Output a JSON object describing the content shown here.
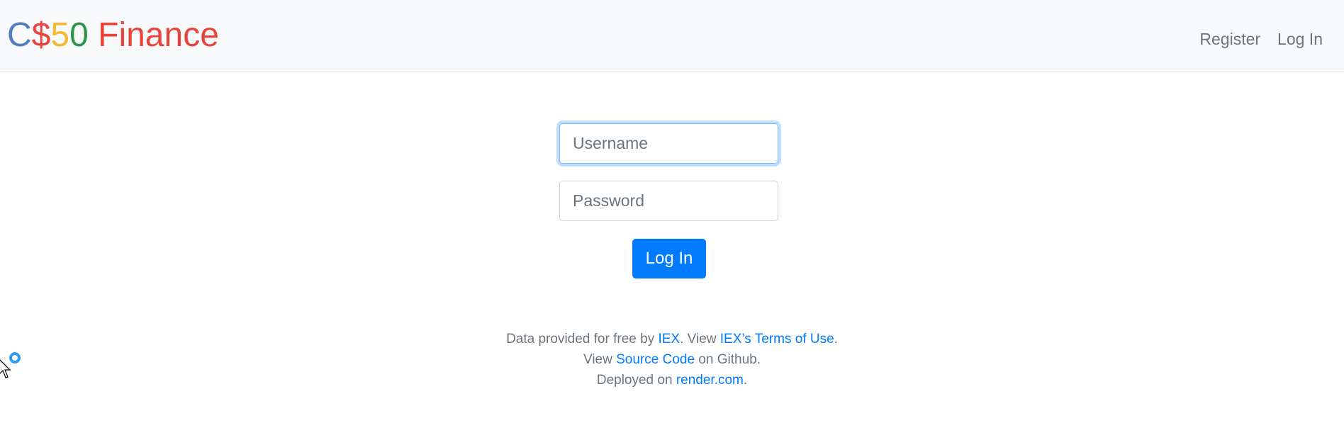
{
  "brand": {
    "parts": [
      {
        "text": "C",
        "color": "#537fbe"
      },
      {
        "text": "$",
        "color": "#ea433b"
      },
      {
        "text": "5",
        "color": "#f5b82e"
      },
      {
        "text": "0",
        "color": "#2e944b"
      },
      {
        "text": " Finance",
        "color": "#ea433b"
      }
    ]
  },
  "nav": {
    "register_label": "Register",
    "login_label": "Log In"
  },
  "form": {
    "username_placeholder": "Username",
    "password_placeholder": "Password",
    "submit_label": "Log In"
  },
  "footer": {
    "line1_prefix": "Data provided for free by ",
    "line1_link1": "IEX",
    "line1_mid": ". View ",
    "line1_link2": "IEX’s Terms of Use",
    "line1_suffix": ".",
    "line2_prefix": "View ",
    "line2_link": "Source Code",
    "line2_suffix": " on Github.",
    "line3_prefix": "Deployed on ",
    "line3_link": "render.com",
    "line3_suffix": "."
  },
  "colors": {
    "accent": "#007bff",
    "navbar_bg": "#f8f9fa",
    "muted_text": "#6c757d"
  }
}
